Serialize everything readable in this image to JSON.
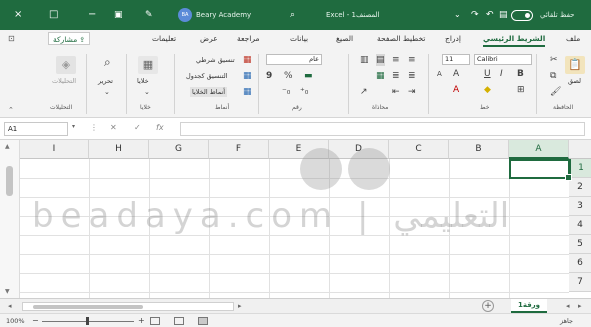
{
  "title_bar": {
    "close_icon": "×",
    "restore_icon": "□",
    "minimize_icon": "−",
    "app_name": "Beary Academy",
    "avatar_initials": "BA",
    "file_title": "Excel - المصنف1",
    "autosave_label": "حفظ تلقائي",
    "search_icon": "search-icon",
    "save_icon": "save-icon"
  },
  "ribbon_tabs": [
    {
      "label": "ملف"
    },
    {
      "label": "الشريط الرئيسي",
      "active": true
    },
    {
      "label": "إدراج"
    },
    {
      "label": "تخطيط الصفحة"
    },
    {
      "label": "الصيغ"
    },
    {
      "label": "بيانات"
    },
    {
      "label": "مراجعة"
    },
    {
      "label": "عرض"
    },
    {
      "label": "تعليمات"
    }
  ],
  "share_label": "مشاركة",
  "ribbon": {
    "clipboard": {
      "label": "الحافظة",
      "paste_label": "لصق"
    },
    "font": {
      "label": "خط",
      "name": "Calibri",
      "size": "11",
      "bold": "B",
      "italic": "I",
      "underline": "U",
      "grow": "A",
      "shrink": "A"
    },
    "alignment": {
      "label": "محاذاة"
    },
    "number": {
      "label": "رقم",
      "format": "عام",
      "percent": "%",
      "comma": "9"
    },
    "styles": {
      "label": "أنماط",
      "conditional": "تنسيق شرطي",
      "table": "التنسيق كجدول",
      "cell_styles": "أنماط الخلايا"
    },
    "cells": {
      "label": "خلايا"
    },
    "editing": {
      "label": "تحرير"
    },
    "analysis": {
      "label": "التحليلات"
    }
  },
  "formula_bar": {
    "name_box": "A1",
    "fx": "fx",
    "value": ""
  },
  "grid": {
    "columns": [
      "A",
      "B",
      "C",
      "D",
      "E",
      "F",
      "G",
      "H",
      "I"
    ],
    "rows": [
      "1",
      "2",
      "3",
      "4",
      "5",
      "6",
      "7"
    ],
    "selected_cell": "A1"
  },
  "watermark": {
    "text": "beadaya.com | التعليمي"
  },
  "sheet_tabs": [
    {
      "label": "ورقة1",
      "active": true
    }
  ],
  "add_sheet_label": "+",
  "status_bar": {
    "zoom": "100%",
    "zoom_minus": "−",
    "zoom_plus": "+",
    "ready": "جاهز"
  }
}
